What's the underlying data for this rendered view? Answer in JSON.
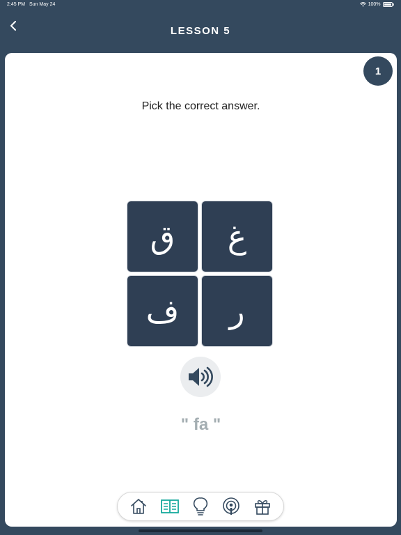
{
  "status_bar": {
    "time": "2:45 PM",
    "date": "Sun May 24",
    "battery": "100%"
  },
  "header": {
    "title": "LESSON 5"
  },
  "quiz": {
    "counter": "1",
    "prompt": "Pick the correct answer.",
    "options": [
      "ق",
      "غ",
      "ف",
      "ر"
    ],
    "pronunciation": "\" fa \""
  },
  "tabbar": {
    "items": [
      "home-icon",
      "book-icon",
      "lightbulb-icon",
      "podcast-icon",
      "gift-icon"
    ],
    "active_index": 1,
    "active_color": "#16a99c",
    "inactive_color": "#34495e"
  },
  "colors": {
    "background": "#34495e",
    "tile": "#2f3f54",
    "pronunciation": "#a4aeb2"
  }
}
